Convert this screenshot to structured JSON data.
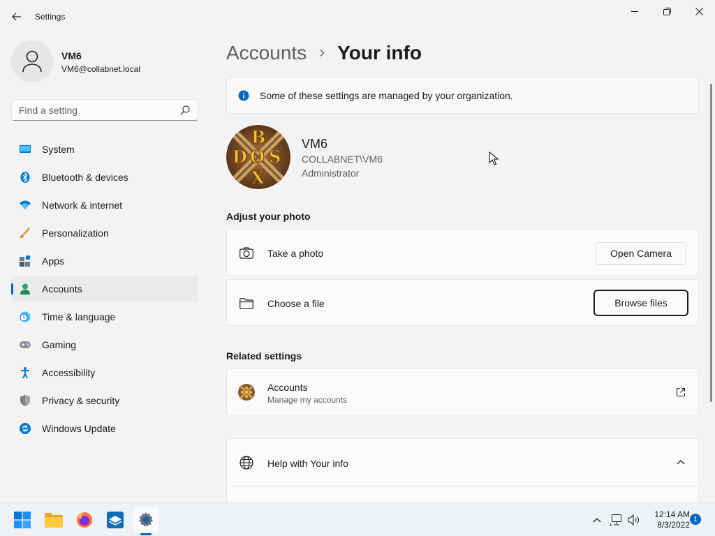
{
  "window": {
    "title": "Settings"
  },
  "profile": {
    "name": "VM6",
    "email": "VM6@collabnet.local"
  },
  "search": {
    "placeholder": "Find a setting",
    "value": ""
  },
  "sidebar": {
    "items": [
      {
        "label": "System",
        "icon": "system-icon",
        "active": false
      },
      {
        "label": "Bluetooth & devices",
        "icon": "bluetooth-icon",
        "active": false
      },
      {
        "label": "Network & internet",
        "icon": "wifi-icon",
        "active": false
      },
      {
        "label": "Personalization",
        "icon": "paintbrush-icon",
        "active": false
      },
      {
        "label": "Apps",
        "icon": "apps-icon",
        "active": false
      },
      {
        "label": "Accounts",
        "icon": "person-icon",
        "active": true
      },
      {
        "label": "Time & language",
        "icon": "clock-globe-icon",
        "active": false
      },
      {
        "label": "Gaming",
        "icon": "gamepad-icon",
        "active": false
      },
      {
        "label": "Accessibility",
        "icon": "accessibility-icon",
        "active": false
      },
      {
        "label": "Privacy & security",
        "icon": "shield-icon",
        "active": false
      },
      {
        "label": "Windows Update",
        "icon": "update-icon",
        "active": false
      }
    ]
  },
  "breadcrumb": {
    "parent": "Accounts",
    "current": "Your info"
  },
  "info_bar": {
    "text": "Some of these settings are managed by your organization."
  },
  "user": {
    "name": "VM6",
    "domain": "COLLABNET\\VM6",
    "role": "Administrator"
  },
  "adjust_photo": {
    "heading": "Adjust your photo",
    "take_photo": {
      "label": "Take a photo",
      "button": "Open Camera"
    },
    "choose_file": {
      "label": "Choose a file",
      "button": "Browse files"
    }
  },
  "related": {
    "heading": "Related settings",
    "accounts": {
      "label": "Accounts",
      "sub": "Manage my accounts"
    }
  },
  "help": {
    "label": "Help with Your info"
  },
  "taskbar": {
    "apps": [
      "start-icon",
      "file-explorer-icon",
      "firefox-icon",
      "store-icon",
      "settings-icon"
    ],
    "time": "12:14 AM",
    "date": "8/3/2022",
    "notifications": "1"
  },
  "colors": {
    "accent": "#0067c0",
    "background": "#f3f3f3",
    "card": "#fbfbfb"
  }
}
